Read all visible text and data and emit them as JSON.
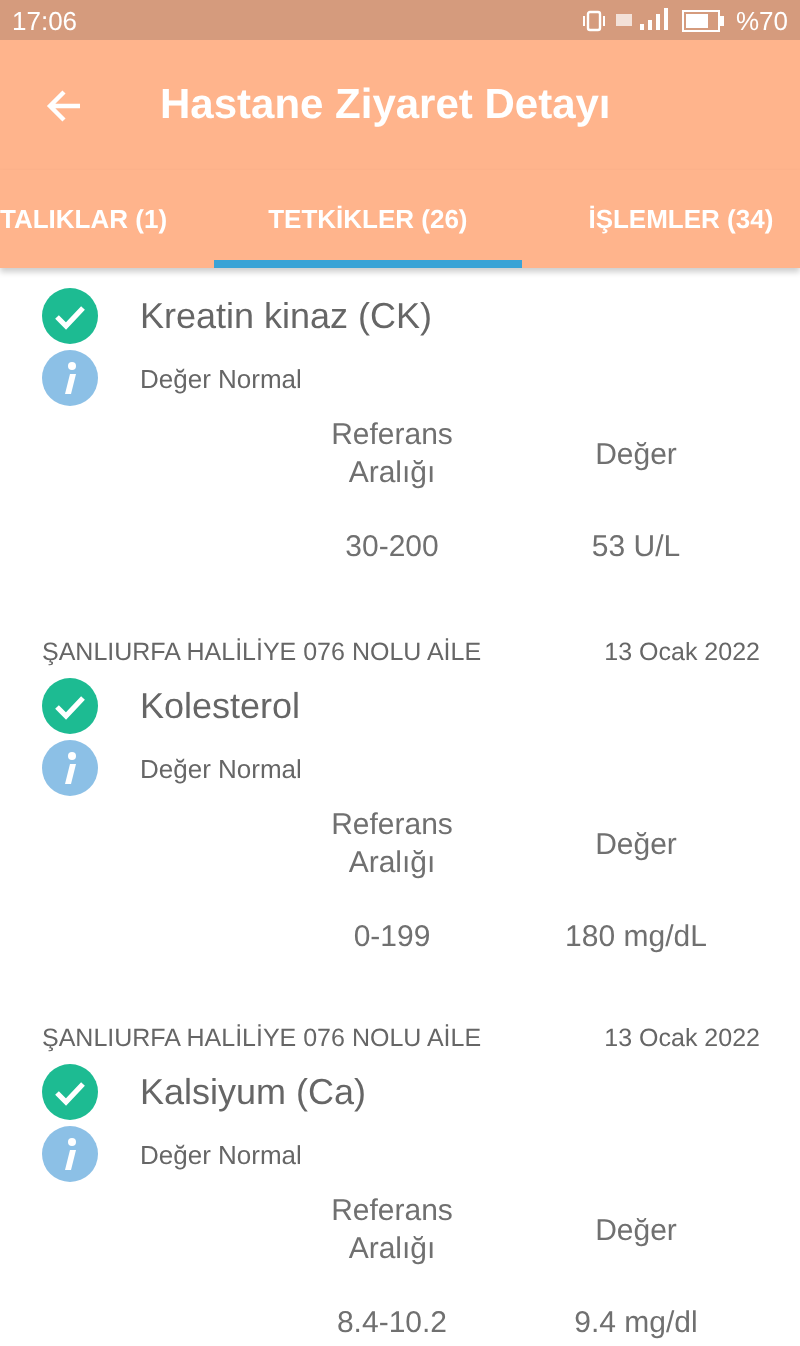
{
  "status_bar": {
    "time": "17:06",
    "battery": "%70"
  },
  "app_bar": {
    "title": "Hastane Ziyaret Detayı"
  },
  "tabs": [
    {
      "label": "TALIKLAR (1)",
      "selected": false
    },
    {
      "label": "TETKİKLER (26)",
      "selected": true
    },
    {
      "label": "İŞLEMLER (34)",
      "selected": false
    }
  ],
  "tests": [
    {
      "name": "Kreatin kinaz (CK)",
      "normal": true,
      "note": "Değer Normal",
      "reference_label": "Referans Aralığı",
      "value_label": "Değer",
      "reference": "30-200",
      "value": "53 U/L"
    },
    {
      "facility": "ŞANLIURFA HALİLİYE 076 NOLU AİLE",
      "date": "13 Ocak 2022",
      "name": "Kolesterol",
      "normal": true,
      "note": "Değer Normal",
      "reference_label": "Referans Aralığı",
      "value_label": "Değer",
      "reference": "0-199",
      "value": "180 mg/dL"
    },
    {
      "facility": "ŞANLIURFA HALİLİYE 076 NOLU AİLE",
      "date": "13 Ocak 2022",
      "name": "Kalsiyum (Ca)",
      "normal": true,
      "note": "Değer Normal",
      "reference_label": "Referans Aralığı",
      "value_label": "Değer",
      "reference": "8.4-10.2",
      "value": "9.4 mg/dl"
    }
  ]
}
